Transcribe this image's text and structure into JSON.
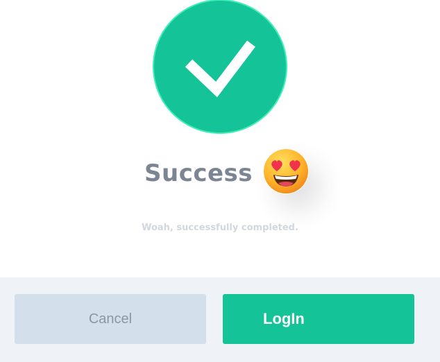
{
  "dialog": {
    "status_icon": "checkmark-icon",
    "title": "Success",
    "title_emoji": "heart-eyes-emoji-icon",
    "message": "Woah, successfully completed.",
    "cancel_label": "Cancel",
    "login_label": "LogIn"
  },
  "colors": {
    "accent": "#14c397",
    "accent_border": "#3cf0b5",
    "title_text": "#7c8593",
    "message_text": "#d2d7de",
    "footer_bg": "#eff2f6",
    "cancel_bg": "#d3dfeb",
    "cancel_text": "#8a97a6"
  }
}
